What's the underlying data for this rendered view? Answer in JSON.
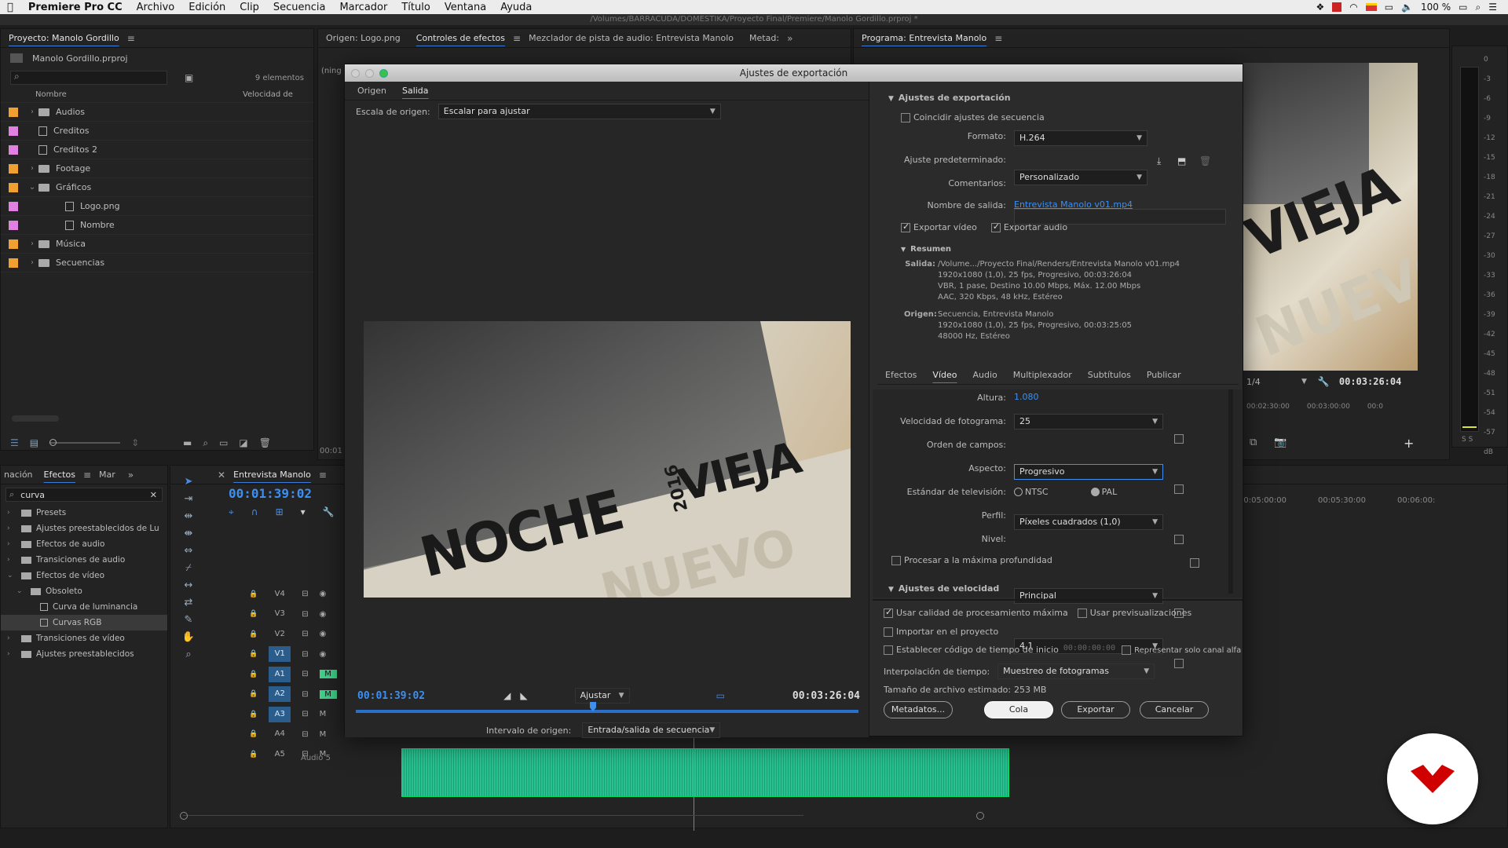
{
  "menubar": {
    "app": "Premiere Pro CC",
    "items": [
      "Archivo",
      "Edición",
      "Clip",
      "Secuencia",
      "Marcador",
      "Título",
      "Ventana",
      "Ayuda"
    ],
    "battery": "100 %"
  },
  "path_title": "/Volumes/BARRACUDA/DOMESTIKA/Proyecto Final/Premiere/Manolo Gordillo.prproj *",
  "project": {
    "tab": "Proyecto: Manolo Gordillo",
    "file": "Manolo Gordillo.prproj",
    "count": "9 elementos",
    "col_name": "Nombre",
    "col_speed": "Velocidad de",
    "items": [
      {
        "name": "Audios",
        "type": "folder",
        "color": "#f0a030",
        "expand": true
      },
      {
        "name": "Creditos",
        "type": "seq",
        "color": "#e080e0",
        "expand": false
      },
      {
        "name": "Creditos 2",
        "type": "seq",
        "color": "#e080e0",
        "expand": false
      },
      {
        "name": "Footage",
        "type": "folder",
        "color": "#f0a030",
        "expand": true
      },
      {
        "name": "Gráficos",
        "type": "folder",
        "color": "#f0a030",
        "expand": true,
        "open": true
      },
      {
        "name": "Logo.png",
        "type": "file",
        "color": "#e080e0",
        "indent": true
      },
      {
        "name": "Nombre",
        "type": "file",
        "color": "#e080e0",
        "indent": true
      },
      {
        "name": "Música",
        "type": "folder",
        "color": "#f0a030",
        "expand": true
      },
      {
        "name": "Secuencias",
        "type": "folder",
        "color": "#f0a030",
        "expand": true
      }
    ]
  },
  "source": {
    "tabs": [
      "Origen: Logo.png",
      "Controles de efectos",
      "Mezclador de pista de audio: Entrevista Manolo",
      "Metad:"
    ],
    "side_text": "(ning",
    "side_time": "00:01"
  },
  "program": {
    "tab": "Programa: Entrevista Manolo",
    "zoom": "1/4",
    "time": "00:03:26:04",
    "ruler": [
      "00:02:30:00",
      "00:03:00:00",
      "00:0"
    ]
  },
  "meter": {
    "ticks": [
      "0",
      "-3",
      "-6",
      "-9",
      "-12",
      "-15",
      "-18",
      "-21",
      "-24",
      "-27",
      "-30",
      "-33",
      "-36",
      "-39",
      "-42",
      "-45",
      "-48",
      "-51",
      "-54",
      "-57",
      "dB"
    ],
    "solo": "S S"
  },
  "effects": {
    "tabs": [
      "nación",
      "Efectos",
      "Mar"
    ],
    "search": "curva",
    "tree": [
      {
        "name": "Presets",
        "lvl": 0
      },
      {
        "name": "Ajustes preestablecidos de Lu",
        "lvl": 0
      },
      {
        "name": "Efectos de audio",
        "lvl": 0
      },
      {
        "name": "Transiciones de audio",
        "lvl": 0
      },
      {
        "name": "Efectos de vídeo",
        "lvl": 0,
        "open": true
      },
      {
        "name": "Obsoleto",
        "lvl": 1,
        "open": true
      },
      {
        "name": "Curva de luminancia",
        "lvl": 2
      },
      {
        "name": "Curvas RGB",
        "lvl": 2,
        "sel": true
      },
      {
        "name": "Transiciones de vídeo",
        "lvl": 0
      },
      {
        "name": "Ajustes preestablecidos",
        "lvl": 0
      }
    ]
  },
  "timeline": {
    "tab": "Entrevista Manolo",
    "time": "00:01:39:02",
    "tracks": [
      "V4",
      "V3",
      "V2",
      "V1",
      "A1",
      "A2",
      "A3",
      "A4",
      "A5"
    ],
    "audio5": "Audio 5",
    "ruler": [
      "00:05:00:00",
      "00:05:30:00",
      "00:06:00:"
    ]
  },
  "dialog": {
    "title": "Ajustes de exportación",
    "tabs": [
      "Origen",
      "Salida"
    ],
    "source_scale_label": "Escala de origen:",
    "source_scale": "Escalar para ajustar",
    "preview_text": {
      "noche": "NOCHE",
      "year": "2016",
      "vieja": "VIEJA",
      "nuevo": "NUEVO"
    },
    "time_in": "00:01:39:02",
    "fit": "Ajustar",
    "time_out": "00:03:26:04",
    "range_label": "Intervalo de origen:",
    "range": "Entrada/salida de secuencia",
    "export_settings": {
      "section": "Ajustes de exportación",
      "match_seq": "Coincidir ajustes de secuencia",
      "format_label": "Formato:",
      "format": "H.264",
      "preset_label": "Ajuste predeterminado:",
      "preset": "Personalizado",
      "comments_label": "Comentarios:",
      "output_label": "Nombre de salida:",
      "output": "Entrevista Manolo v01.mp4",
      "export_video": "Exportar vídeo",
      "export_audio": "Exportar audio",
      "summary": "Resumen",
      "out_label": "Salida:",
      "out_lines": [
        "/Volume.../Proyecto Final/Renders/Entrevista Manolo v01.mp4",
        "1920x1080 (1,0), 25 fps, Progresivo, 00:03:26:04",
        "VBR, 1 pase, Destino 10.00 Mbps, Máx. 12.00 Mbps",
        "AAC, 320 Kbps, 48 kHz, Estéreo"
      ],
      "src_label": "Origen:",
      "src_lines": [
        "Secuencia, Entrevista Manolo",
        "1920x1080 (1,0), 25 fps, Progresivo, 00:03:25:05",
        "48000 Hz, Estéreo"
      ]
    },
    "settings_tabs": [
      "Efectos",
      "Vídeo",
      "Audio",
      "Multiplexador",
      "Subtítulos",
      "Publicar"
    ],
    "video": {
      "height_label": "Altura:",
      "height": "1.080",
      "fps_label": "Velocidad de fotograma:",
      "fps": "25",
      "field_label": "Orden de campos:",
      "field": "Progresivo",
      "aspect_label": "Aspecto:",
      "aspect": "Píxeles cuadrados (1,0)",
      "tv_label": "Estándar de televisión:",
      "ntsc": "NTSC",
      "pal": "PAL",
      "profile_label": "Perfil:",
      "profile": "Principal",
      "level_label": "Nivel:",
      "level": "4,1",
      "max_depth": "Procesar a la máxima profundidad",
      "speed_section": "Ajustes de velocidad"
    },
    "bottom": {
      "max_quality": "Usar calidad de procesamiento máxima",
      "use_previews": "Usar previsualizaciones",
      "import_project": "Importar en el proyecto",
      "set_timecode": "Establecer código de tiempo de inicio",
      "timecode": "00:00:00:00",
      "alpha_only": "Representar solo canal alfa",
      "interp_label": "Interpolación de tiempo:",
      "interp": "Muestreo de fotogramas",
      "size_label": "Tamaño de archivo estimado:",
      "size": "253 MB",
      "metadata": "Metadatos...",
      "queue": "Cola",
      "export": "Exportar",
      "cancel": "Cancelar"
    }
  },
  "brand_color": "#d10000"
}
